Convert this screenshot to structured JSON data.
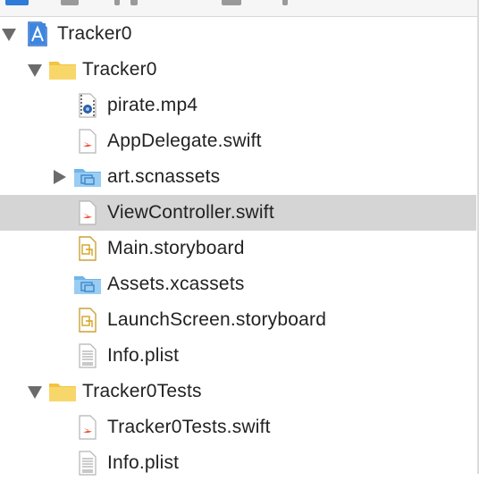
{
  "navigator": {
    "items": [
      {
        "label": "Tracker0",
        "icon": "xcode-project-icon",
        "disclosure": "expanded"
      },
      {
        "label": "Tracker0",
        "icon": "folder-icon",
        "disclosure": "expanded"
      },
      {
        "label": "pirate.mp4",
        "icon": "video-file-icon",
        "disclosure": "none"
      },
      {
        "label": "AppDelegate.swift",
        "icon": "swift-file-icon",
        "disclosure": "none"
      },
      {
        "label": "art.scnassets",
        "icon": "asset-folder-icon",
        "disclosure": "collapsed"
      },
      {
        "label": "ViewController.swift",
        "icon": "swift-file-icon",
        "disclosure": "none",
        "selected": true
      },
      {
        "label": "Main.storyboard",
        "icon": "storyboard-file-icon",
        "disclosure": "none"
      },
      {
        "label": "Assets.xcassets",
        "icon": "asset-folder-icon",
        "disclosure": "none"
      },
      {
        "label": "LaunchScreen.storyboard",
        "icon": "storyboard-file-icon",
        "disclosure": "none"
      },
      {
        "label": "Info.plist",
        "icon": "plist-file-icon",
        "disclosure": "none"
      },
      {
        "label": "Tracker0Tests",
        "icon": "folder-icon",
        "disclosure": "expanded"
      },
      {
        "label": "Tracker0Tests.swift",
        "icon": "swift-file-icon",
        "disclosure": "none"
      },
      {
        "label": "Info.plist",
        "icon": "plist-file-icon",
        "disclosure": "none"
      }
    ],
    "selected_row_color": "#d5d5d5",
    "folder_color": "#f6c94a",
    "asset_folder_color": "#8ec9f2",
    "swift_color": "#f05138"
  }
}
